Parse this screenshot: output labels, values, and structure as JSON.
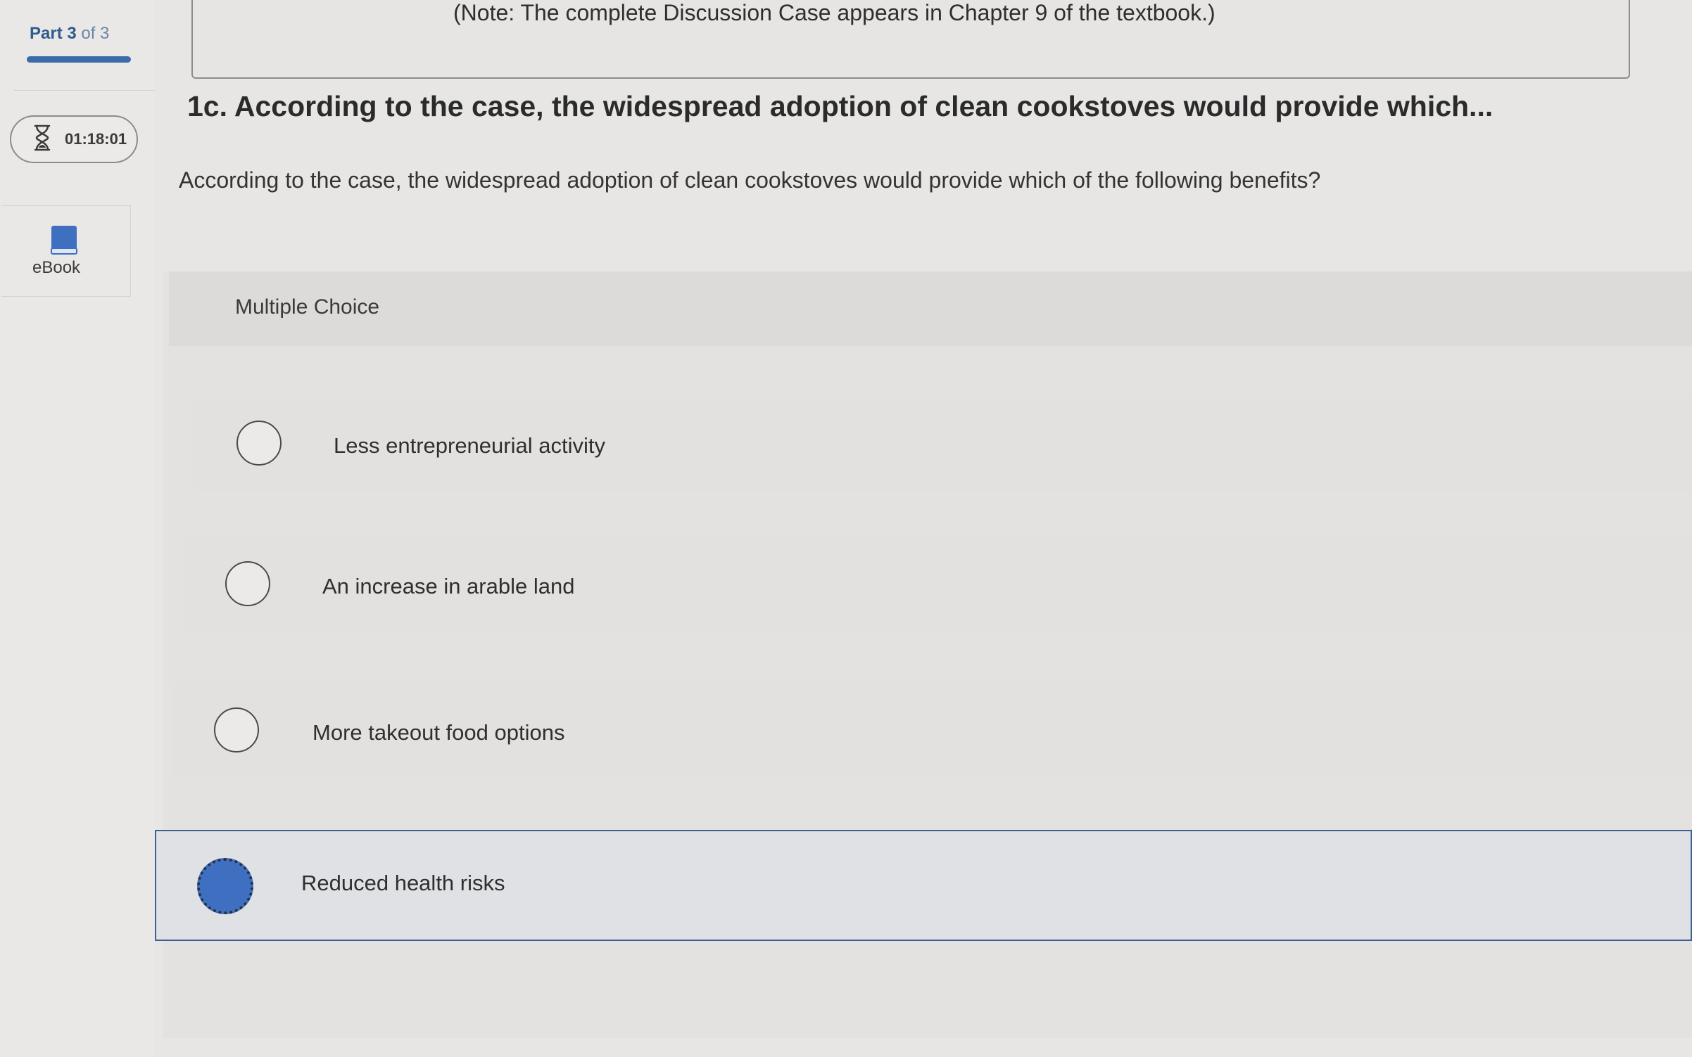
{
  "sidebar": {
    "part_word": "Part 3",
    "part_of": "of 3",
    "timer": "01:18:01",
    "ebook_label": "eBook"
  },
  "note": "(Note: The complete Discussion Case appears in Chapter 9 of the textbook.)",
  "question": {
    "title": "1c. According to the case, the widespread adoption of clean cookstoves would provide which...",
    "body": "According to the case, the widespread adoption of clean cookstoves would provide which of the following benefits?"
  },
  "multiple_choice": {
    "label": "Multiple Choice",
    "options": [
      {
        "text": "Less entrepreneurial activity",
        "selected": false
      },
      {
        "text": "An increase in arable land",
        "selected": false
      },
      {
        "text": "More takeout food options",
        "selected": false
      },
      {
        "text": "Reduced health risks",
        "selected": true
      }
    ]
  },
  "colors": {
    "accent": "#3b6ba8",
    "selected_radio": "#3e6fc0",
    "selected_border": "#3e5f90"
  },
  "icons": [
    "hourglass-icon",
    "ebook-icon"
  ]
}
